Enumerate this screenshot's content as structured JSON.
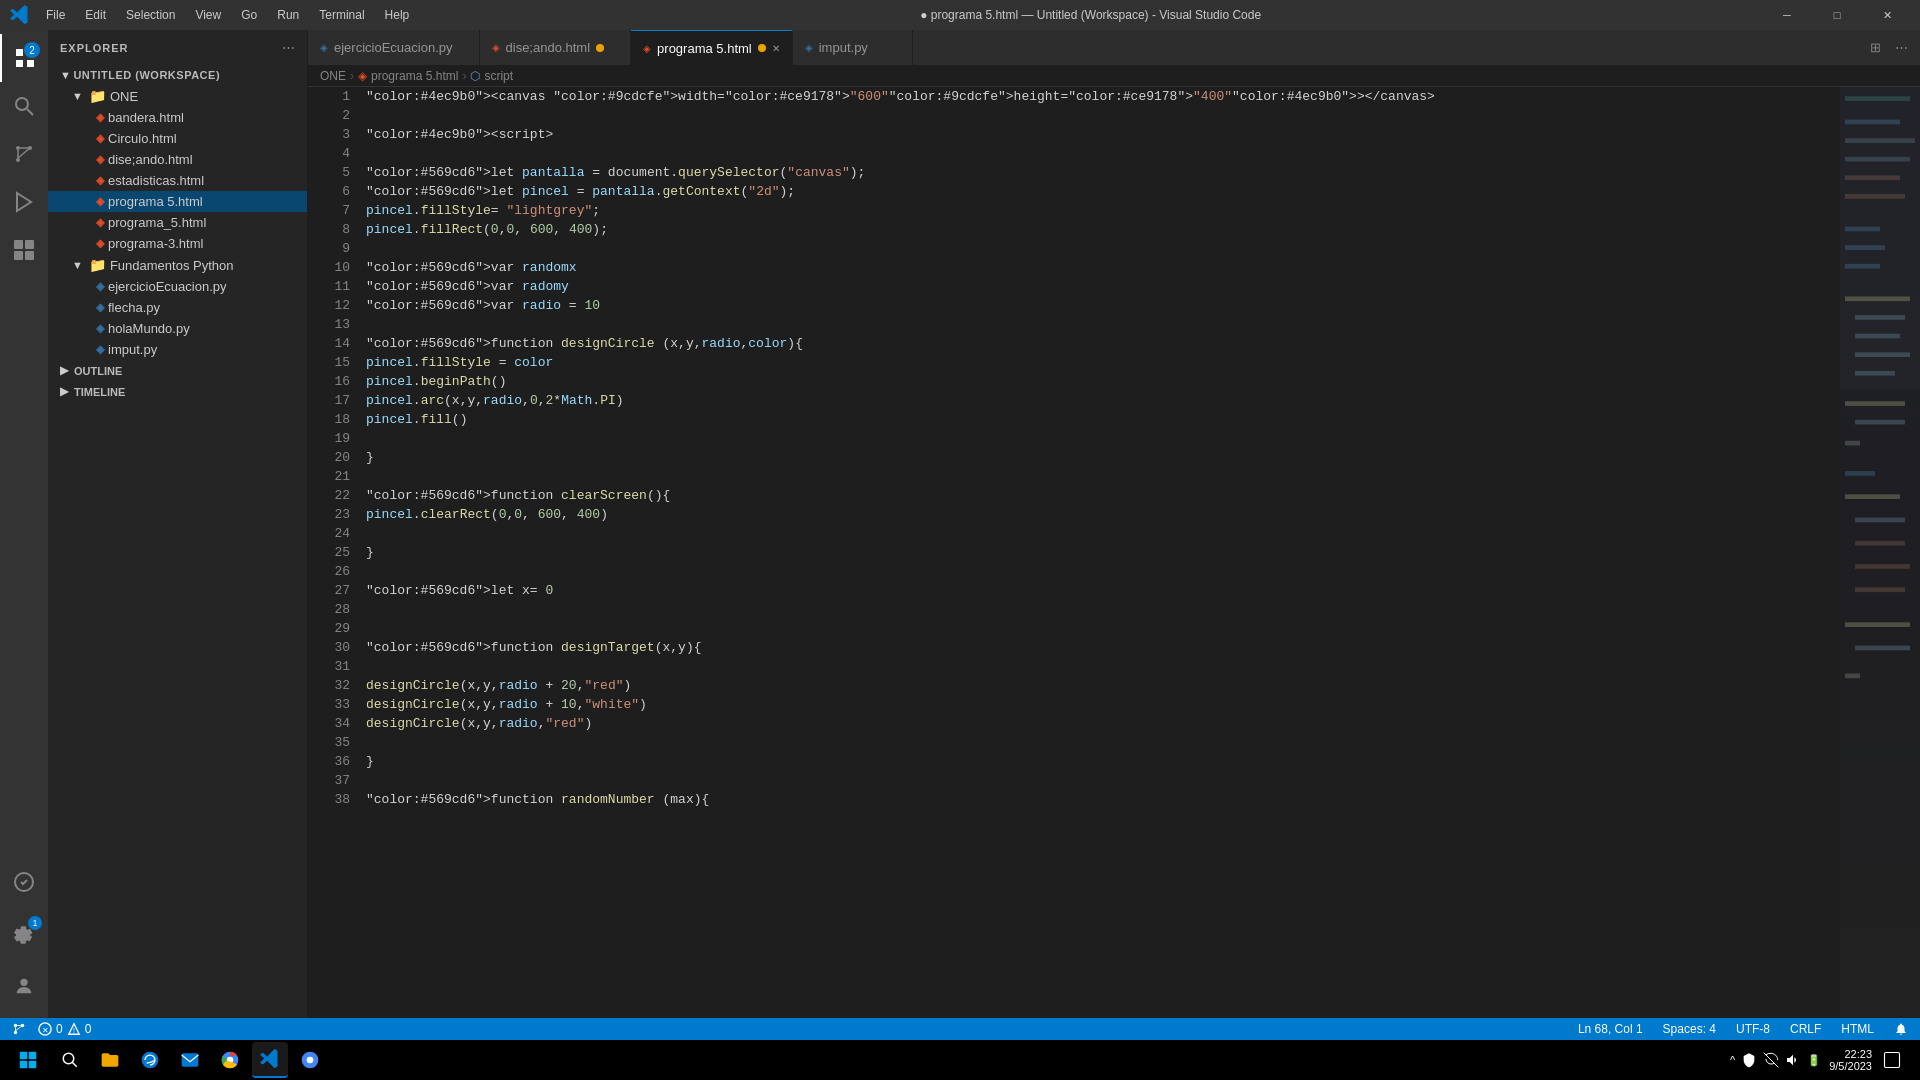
{
  "titlebar": {
    "menu": [
      "File",
      "Edit",
      "Selection",
      "View",
      "Go",
      "Run",
      "Terminal",
      "Help"
    ],
    "title": "● programa 5.html — Untitled (Workspace) - Visual Studio Code",
    "controls": [
      "─",
      "□",
      "✕"
    ]
  },
  "sidebar": {
    "header": "EXPLORER",
    "workspace": "UNTITLED (WORKSPACE)",
    "folders": [
      {
        "name": "ONE",
        "expanded": true,
        "files": [
          {
            "name": "bandera.html",
            "type": "html"
          },
          {
            "name": "Circulo.html",
            "type": "html"
          },
          {
            "name": "dise;ando.html",
            "type": "html"
          },
          {
            "name": "estadisticas.html",
            "type": "html"
          },
          {
            "name": "programa 5.html",
            "type": "html",
            "selected": true
          },
          {
            "name": "programa_5.html",
            "type": "html"
          },
          {
            "name": "programa-3.html",
            "type": "html"
          }
        ]
      },
      {
        "name": "Fundamentos Python",
        "expanded": true,
        "files": [
          {
            "name": "ejercicioEcuacion.py",
            "type": "py"
          },
          {
            "name": "flecha.py",
            "type": "py"
          },
          {
            "name": "holaMundo.py",
            "type": "py"
          },
          {
            "name": "imput.py",
            "type": "py"
          }
        ]
      }
    ],
    "outline_label": "OUTLINE",
    "timeline_label": "TIMELINE"
  },
  "tabs": [
    {
      "label": "ejercicioEcuacion.py",
      "modified": false,
      "active": false
    },
    {
      "label": "dise;ando.html",
      "modified": true,
      "active": false
    },
    {
      "label": "programa 5.html",
      "modified": true,
      "active": true
    },
    {
      "label": "imput.py",
      "modified": false,
      "active": false
    }
  ],
  "breadcrumb": {
    "parts": [
      "ONE",
      "programa 5.html",
      "script"
    ]
  },
  "code": {
    "lines": [
      {
        "num": 1,
        "content": "<canvas width=\"600\" height=\"400\"></canvas>"
      },
      {
        "num": 2,
        "content": ""
      },
      {
        "num": 3,
        "content": "<script>"
      },
      {
        "num": 4,
        "content": ""
      },
      {
        "num": 5,
        "content": "let pantalla = document.querySelector(\"canvas\");"
      },
      {
        "num": 6,
        "content": "let pincel = pantalla.getContext(\"2d\");"
      },
      {
        "num": 7,
        "content": "pincel.fillStyle= \"lightgrey\";"
      },
      {
        "num": 8,
        "content": "pincel.fillRect(0,0, 600, 400);"
      },
      {
        "num": 9,
        "content": ""
      },
      {
        "num": 10,
        "content": "var randomx"
      },
      {
        "num": 11,
        "content": "var radomy"
      },
      {
        "num": 12,
        "content": "var radio = 10"
      },
      {
        "num": 13,
        "content": ""
      },
      {
        "num": 14,
        "content": "function designCircle (x,y,radio,color){"
      },
      {
        "num": 15,
        "content": "    pincel.fillStyle = color"
      },
      {
        "num": 16,
        "content": "    pincel.beginPath()"
      },
      {
        "num": 17,
        "content": "    pincel.arc(x,y,radio,0,2*Math.PI)"
      },
      {
        "num": 18,
        "content": "    pincel.fill()"
      },
      {
        "num": 19,
        "content": ""
      },
      {
        "num": 20,
        "content": "}"
      },
      {
        "num": 21,
        "content": ""
      },
      {
        "num": 22,
        "content": "function clearScreen(){"
      },
      {
        "num": 23,
        "content": "    pincel.clearRect(0,0, 600, 400)"
      },
      {
        "num": 24,
        "content": ""
      },
      {
        "num": 25,
        "content": "}"
      },
      {
        "num": 26,
        "content": ""
      },
      {
        "num": 27,
        "content": "let x= 0"
      },
      {
        "num": 28,
        "content": ""
      },
      {
        "num": 29,
        "content": ""
      },
      {
        "num": 30,
        "content": "function designTarget(x,y){"
      },
      {
        "num": 31,
        "content": ""
      },
      {
        "num": 32,
        "content": "    designCircle(x,y,radio + 20,\"red\")"
      },
      {
        "num": 33,
        "content": "    designCircle(x,y,radio + 10,\"white\")"
      },
      {
        "num": 34,
        "content": "    designCircle(x,y,radio,\"red\")"
      },
      {
        "num": 35,
        "content": ""
      },
      {
        "num": 36,
        "content": "}"
      },
      {
        "num": 37,
        "content": ""
      },
      {
        "num": 38,
        "content": "function randomNumber (max){"
      }
    ]
  },
  "status": {
    "ln": "Ln 68, Col 1",
    "spaces": "Spaces: 4",
    "encoding": "UTF-8",
    "eol": "CRLF",
    "language": "HTML",
    "errors": "0",
    "warnings": "0"
  },
  "taskbar": {
    "time": "22:23",
    "date": "9/5/2023"
  }
}
